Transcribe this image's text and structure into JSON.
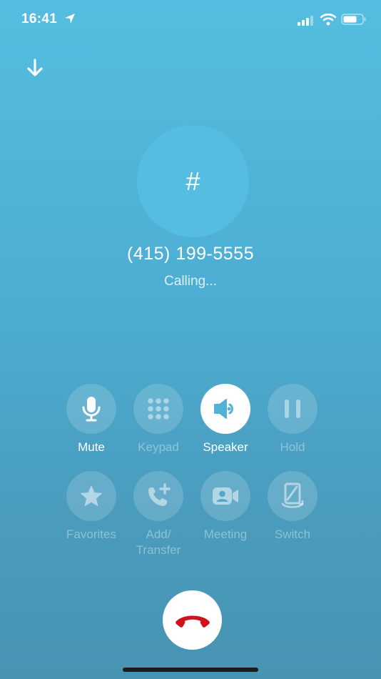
{
  "status_bar": {
    "time": "16:41"
  },
  "caller": {
    "avatar_text": "#",
    "phone_number": "(415) 199-5555",
    "status": "Calling..."
  },
  "controls": {
    "mute": "Mute",
    "keypad": "Keypad",
    "speaker": "Speaker",
    "hold": "Hold",
    "favorites": "Favorites",
    "add_transfer_line1": "Add/",
    "add_transfer_line2": "Transfer",
    "meeting": "Meeting",
    "switch": "Switch"
  },
  "colors": {
    "background_top": "#54bde0",
    "background_bottom": "#4793b2",
    "end_call_icon": "#d0121b"
  },
  "icons": {
    "collapse": "arrow-down-icon",
    "mute": "microphone-icon",
    "keypad": "keypad-grid-icon",
    "speaker": "speaker-icon",
    "hold": "pause-icon",
    "favorites": "star-icon",
    "add_transfer": "phone-plus-icon",
    "meeting": "video-camera-icon",
    "switch": "device-switch-icon",
    "end_call": "hang-up-icon"
  }
}
